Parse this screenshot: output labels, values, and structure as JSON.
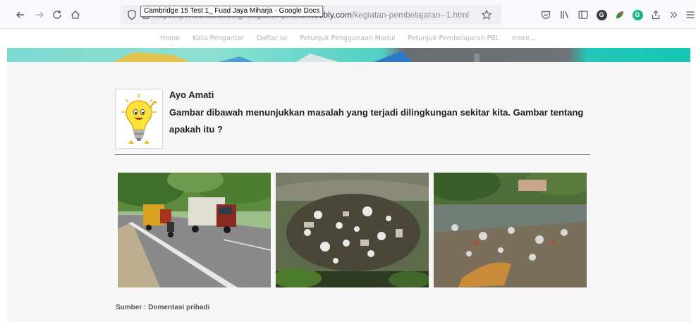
{
  "browser": {
    "tooltip": "Cambridge 15 Test 1_ Fuad Jaya Miharja - Google Docs",
    "url_prefix": "https://pencemarandingkungansmpnon1.",
    "url_host": "weebly.com",
    "url_path": "/kegiatan-pembelajaran--1.html",
    "extension_colors": [
      "#3a3a44",
      "#2f8f3a",
      "#1fb38a"
    ]
  },
  "site_nav": {
    "items": [
      "Home",
      "Kata Pengantar",
      "Daftar Isi",
      "Petunjuk Penggunaan Modul",
      "Petunjuk Pembelajaran PBL",
      "more..."
    ]
  },
  "content": {
    "heading": "Ayo Amati",
    "question": "Gambar dibawah menunjukkan masalah yang terjadi dilingkungan sekitar kita. Gambar tentang apakah itu ?",
    "source": "Sumber : Domentasi pribadi"
  },
  "colors": {
    "banner_teal": "#22c7b8",
    "banner_gray": "#6d7376"
  }
}
